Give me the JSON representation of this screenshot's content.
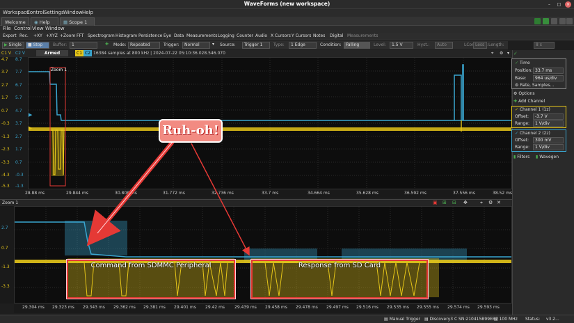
{
  "window": {
    "title": "WaveForms (new workspace)"
  },
  "menu_top": [
    "Workspace",
    "Control",
    "Settings",
    "Window",
    "Help"
  ],
  "tabs": [
    {
      "label": "Welcome"
    },
    {
      "label": "Help"
    },
    {
      "label": "Scope 1"
    }
  ],
  "menu_scope": [
    "File",
    "Control",
    "View",
    "Window"
  ],
  "toolbar_items": [
    "Export",
    "Rec.",
    "+XY",
    "+XYZ",
    "+Zoom",
    "FFT",
    "Spectrogram",
    "Histogram",
    "Persistence",
    "Eye",
    "Data",
    "Measurements",
    "Logging",
    "Counter",
    "Audio",
    "X Cursors",
    "Y Cursors",
    "Notes",
    "Digital",
    "Measurements"
  ],
  "acq": {
    "single": "Single",
    "stop": "Stop",
    "buffer_label": "Buffer:",
    "buffer_val": "1",
    "mode_label": "Mode:",
    "mode_val": "Repeated",
    "trigger_label": "Trigger:",
    "trigger_val": "Normal",
    "source_label": "Source:",
    "source_val": "Trigger 1",
    "type_label": "Type:",
    "type_val": "1 Edge",
    "condition_label": "Condition:",
    "condition_val": "Falling",
    "level_label": "Level:",
    "level_val": "1.5 V",
    "hyst_label": "Hyst.:",
    "hyst_val": "Auto",
    "lcond_label": "LCondition:",
    "lcond_val": "Less",
    "length_label": "Length:",
    "length_val": "8 s"
  },
  "status": {
    "ch1": "C1 V",
    "ch2": "C2 V",
    "armed": "Armed",
    "c1": "C1",
    "c2": "C2",
    "info": "16384 samples at 800 kHz | 2024-07-22 05:10:36.028.546.070"
  },
  "yaxis1_c1": [
    "4.7",
    "3.7",
    "2.7",
    "1.7",
    "0.7",
    "-0.3",
    "-1.3",
    "-2.3",
    "-3.3",
    "-4.3",
    "-5.3"
  ],
  "yaxis1_c2": [
    "8.7",
    "7.7",
    "6.7",
    "5.7",
    "4.7",
    "3.7",
    "2.7",
    "1.7",
    "0.7",
    "-0.3",
    "-1.3"
  ],
  "xaxis1": [
    "28.88 ms",
    "29.844 ms",
    "30.808 ms",
    "31.772 ms",
    "32.736 ms",
    "33.7 ms",
    "34.664 ms",
    "35.628 ms",
    "36.592 ms",
    "37.556 ms",
    "38.52 ms"
  ],
  "zoom1_label": "Zoom 1",
  "zoom_panel": "Zoom 1",
  "yaxis2": [
    "2.7",
    "0.7",
    "-1.3",
    "-3.3"
  ],
  "xaxis2": [
    "29.304 ms",
    "29.323 ms",
    "29.343 ms",
    "29.362 ms",
    "29.381 ms",
    "29.401 ms",
    "29.42 ms",
    "29.439 ms",
    "29.458 ms",
    "29.478 ms",
    "29.497 ms",
    "29.516 ms",
    "29.535 ms",
    "29.555 ms",
    "29.574 ms",
    "29.593 ms"
  ],
  "annotations": {
    "ruhoh": "Ruh-oh!",
    "command": "Command from SDMMC Peripheral",
    "response": "Response from SD Card"
  },
  "panel": {
    "time_title": "Time",
    "position_label": "Position:",
    "position_val": "33.7 ms",
    "base_label": "Base:",
    "base_val": "964 us/div",
    "rate_btn": "Rate, Samples...",
    "options": "Options",
    "add_channel": "Add Channel",
    "ch1_title": "Channel 1 (1z)",
    "ch1_offset_label": "Offset:",
    "ch1_offset_val": "-3.7 V",
    "ch1_range_label": "Range:",
    "ch1_range_val": "1 V/div",
    "ch2_title": "Channel 2 (2z)",
    "ch2_offset_label": "Offset:",
    "ch2_offset_val": "300 mV",
    "ch2_range_label": "Range:",
    "ch2_range_val": "1 V/div",
    "filters": "Filters",
    "waveforms": "Wavegen"
  },
  "bottom": {
    "manual": "Manual Trigger",
    "device": "Discovery3 C SN:210415B99EB7",
    "freq": "100 MHz",
    "status": "Status:",
    "ver": "v3.2..."
  },
  "colors": {
    "ch1": "#e6c619",
    "ch2": "#3aa6d0",
    "annot": "#e53935"
  }
}
